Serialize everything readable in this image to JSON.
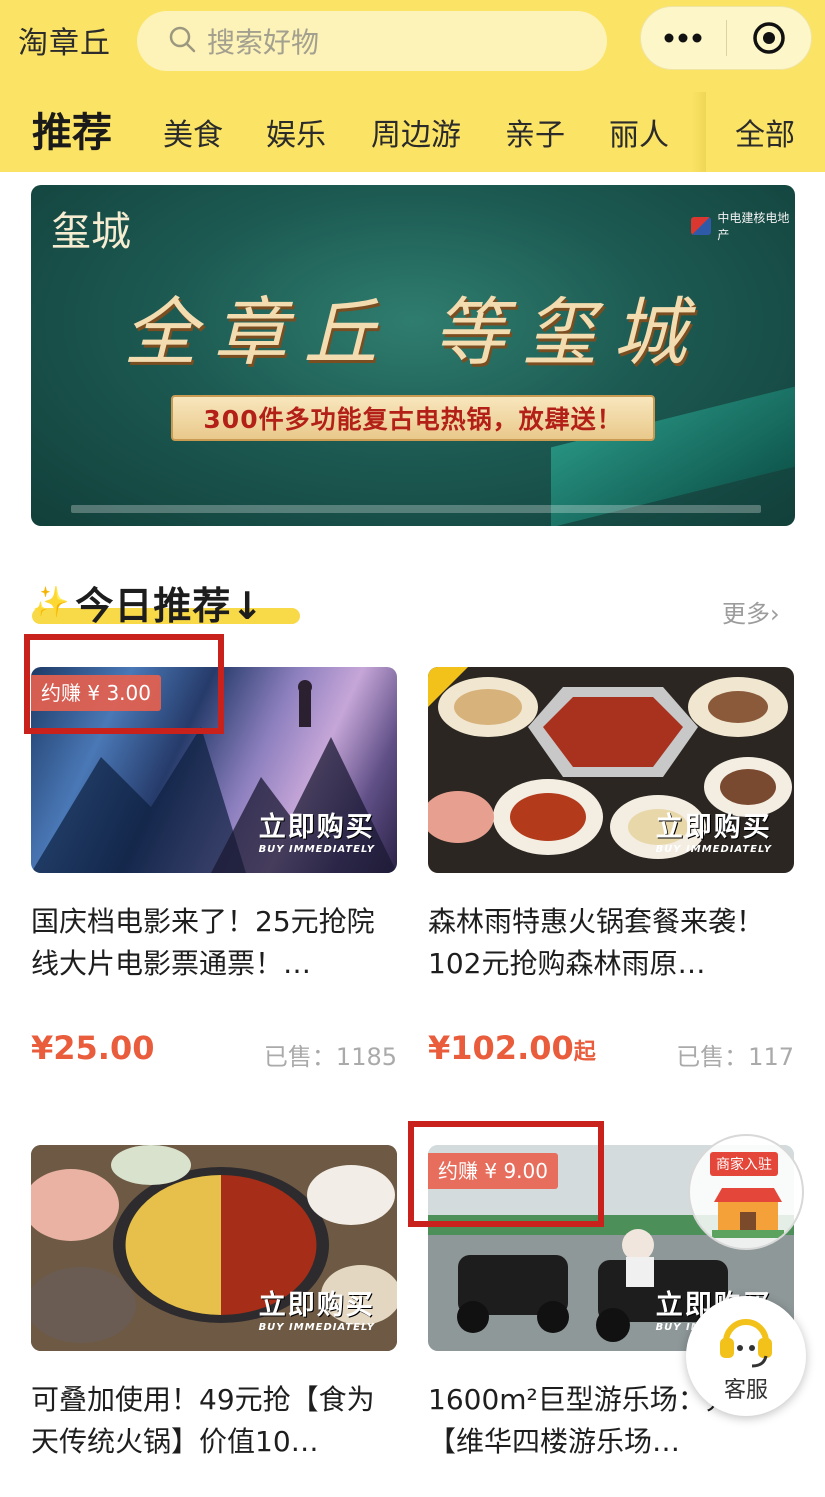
{
  "header": {
    "app_title": "淘章丘",
    "search_placeholder": "搜索好物"
  },
  "nav": {
    "tabs": [
      "推荐",
      "美食",
      "娱乐",
      "周边游",
      "亲子",
      "丽人",
      "全部"
    ]
  },
  "banner": {
    "logo": "玺城",
    "brand": "中电建核电地产",
    "headline": "全章丘 等玺城",
    "promo": "300件多功能复古电热锅，放肆送！"
  },
  "section": {
    "title": "今日推荐↓",
    "more": "更多"
  },
  "products": [
    {
      "earn": "约赚 ¥ 3.00",
      "buy_zh": "立即购买",
      "buy_en": "BUY IMMEDIATELY",
      "title": "国庆档电影来了！25元抢院线大片电影票通票！…",
      "price": "¥25.00",
      "price_unit": "",
      "sold": "已售：1185"
    },
    {
      "earn": "",
      "buy_zh": "立即购买",
      "buy_en": "BUY IMMEDIATELY",
      "title": "森林雨特惠火锅套餐来袭！102元抢购森林雨原…",
      "price": "¥102.00",
      "price_unit": "起",
      "sold": "已售：117"
    },
    {
      "earn": "",
      "buy_zh": "立即购买",
      "buy_en": "BUY IMMEDIATELY",
      "title": "可叠加使用！49元抢【食为天传统火锅】价值10…",
      "price": "",
      "price_unit": "",
      "sold": ""
    },
    {
      "earn": "约赚 ¥ 9.00",
      "buy_zh": "立即购买",
      "buy_en": "BUY IMMEDIATELY",
      "title": "1600m²巨型游乐场：元抢【维华四楼游乐场…",
      "price": "",
      "price_unit": "",
      "sold": ""
    }
  ],
  "floating": {
    "merchant_label": "商家入驻",
    "service_label": "客服"
  }
}
